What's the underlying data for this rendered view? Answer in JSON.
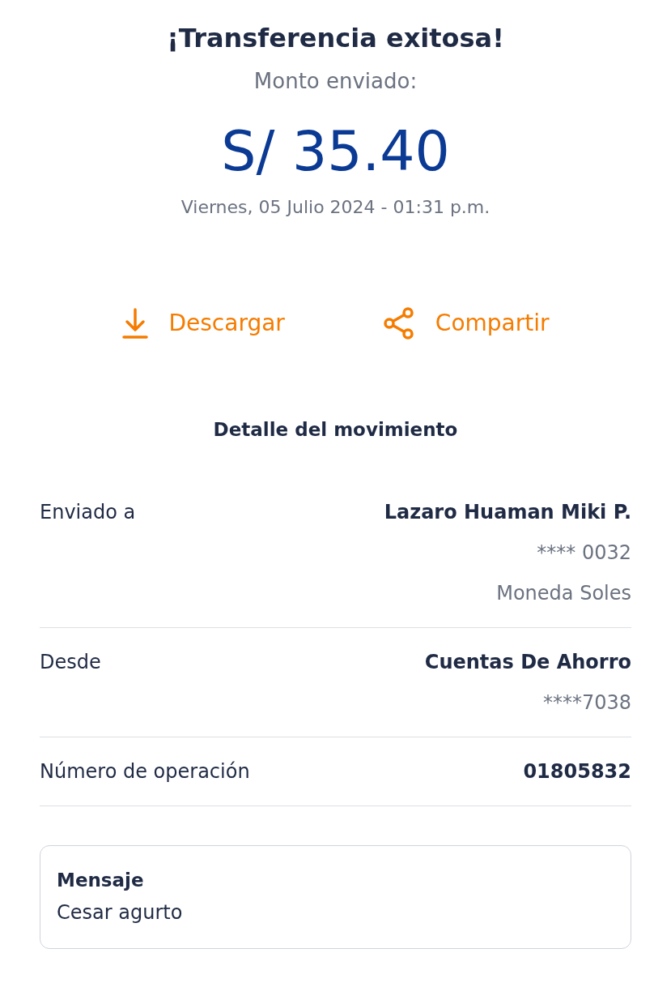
{
  "header": {
    "title": "¡Transferencia exitosa!",
    "subtitle": "Monto enviado:",
    "amount": "S/ 35.40",
    "datetime": "Viernes, 05 Julio 2024 - 01:31 p.m."
  },
  "actions": [
    {
      "kind": "download",
      "label": "Descargar"
    },
    {
      "kind": "share",
      "label": "Compartir"
    }
  ],
  "detail_title": "Detalle del movimiento",
  "details": [
    {
      "label": "Enviado a",
      "values": [
        "Lazaro Huaman Miki P.",
        "**** 0032",
        "Moneda Soles"
      ]
    },
    {
      "label": "Desde",
      "values": [
        "Cuentas De Ahorro",
        "****7038"
      ]
    },
    {
      "label": "Número de operación",
      "values": [
        "01805832"
      ]
    }
  ],
  "message": {
    "title": "Mensaje",
    "text": "Cesar agurto"
  }
}
